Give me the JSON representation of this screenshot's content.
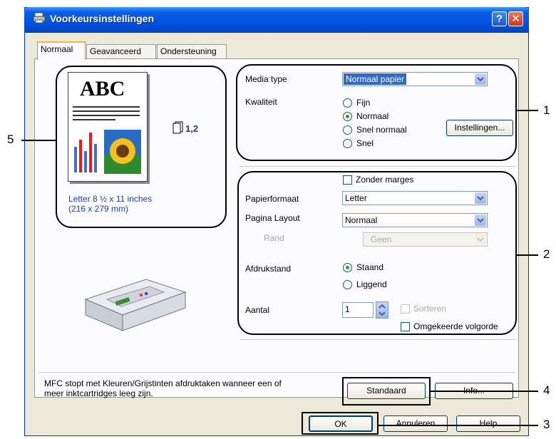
{
  "window": {
    "title": "Voorkeursinstellingen",
    "help_glyph": "?",
    "close_glyph": "✕"
  },
  "tabs": [
    {
      "label": "Normaal",
      "active": true
    },
    {
      "label": "Geavanceerd",
      "active": false
    },
    {
      "label": "Ondersteuning",
      "active": false
    }
  ],
  "preview": {
    "doc_text": "ABC",
    "copies_label": "1,2",
    "paper_line1": "Letter 8 ½ x 11 inches",
    "paper_line2": "(216 x 279 mm)"
  },
  "media": {
    "label": "Media type",
    "value": "Normaal papier"
  },
  "quality": {
    "label": "Kwaliteit",
    "options": [
      "Fijn",
      "Normaal",
      "Snel normaal",
      "Snel"
    ],
    "selected": "Normaal",
    "settings_button": "Instellingen..."
  },
  "borderless": {
    "label": "Zonder marges",
    "checked": false
  },
  "paper_size": {
    "label": "Papierformaat",
    "value": "Letter"
  },
  "page_layout": {
    "label": "Pagina Layout",
    "value": "Normaal"
  },
  "border": {
    "label": "Rand",
    "value": "Geen",
    "disabled": true
  },
  "orientation": {
    "label": "Afdrukstand",
    "options": [
      "Staand",
      "Liggend"
    ],
    "selected": "Staand"
  },
  "copies": {
    "label": "Aantal",
    "value": "1",
    "collate_label": "Sorteren",
    "reverse_label": "Omgekeerde volgorde"
  },
  "info_text": {
    "line1": "MFC stopt met Kleuren/Grijstinten afdruktaken wanneer een of",
    "line2": "meer inktcartridges leeg zijn."
  },
  "buttons": {
    "default": "Standaard",
    "info": "Info...",
    "ok": "OK",
    "cancel": "Annuleren",
    "help": "Help"
  },
  "callouts": [
    "1",
    "2",
    "3",
    "4",
    "5"
  ],
  "colors": {
    "titlebar": "#0054e3",
    "dialog_bg": "#ece9d8",
    "selection": "#316ac5",
    "radio_dot": "#21a121"
  }
}
